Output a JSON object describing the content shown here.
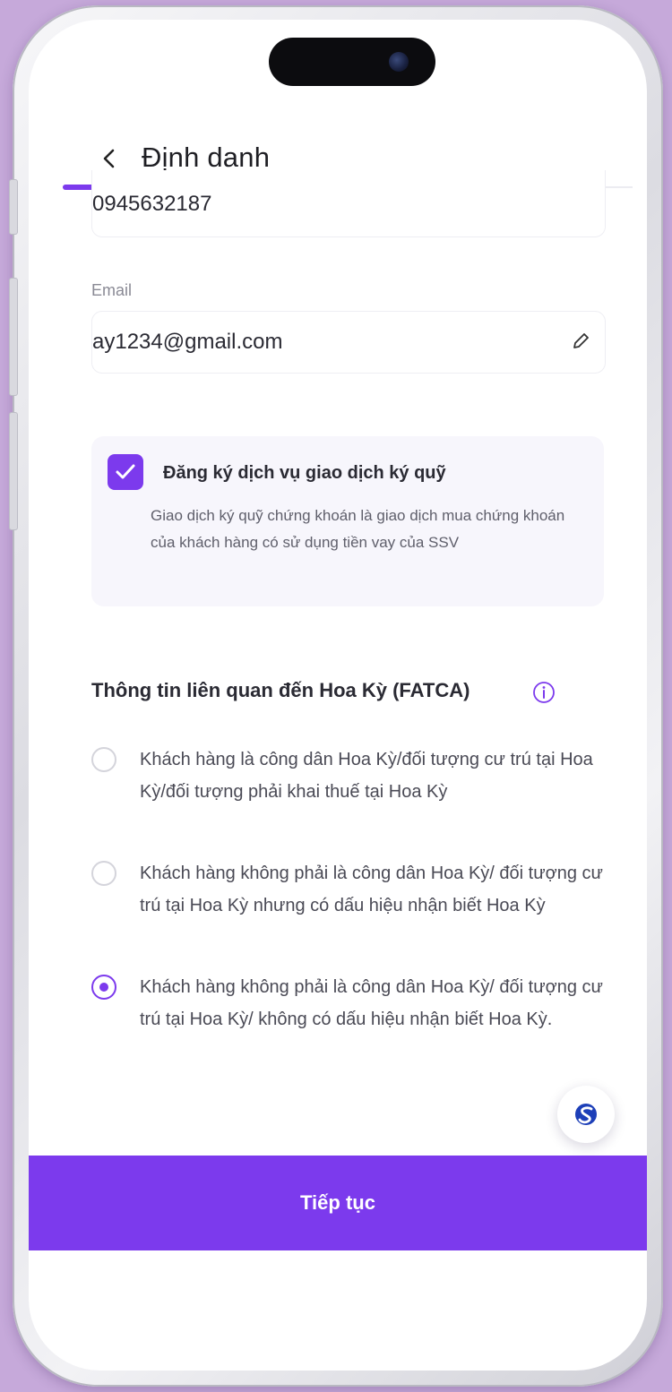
{
  "header": {
    "title": "Định danh",
    "back_icon": "chevron-left-icon"
  },
  "progress": {
    "fraction": 0.25
  },
  "phone_field": {
    "value": "0945632187"
  },
  "email_field": {
    "label": "Email",
    "value": "ay1234@gmail.com",
    "edit_icon": "pencil-icon"
  },
  "margin_service": {
    "checked": true,
    "title": "Đăng ký dịch vụ giao dịch ký quỹ",
    "description": "Giao dịch ký quỹ chứng khoán là giao dịch mua chứng khoán của khách hàng có sử dụng tiền vay của SSV"
  },
  "fatca": {
    "title": "Thông tin liên quan đến Hoa Kỳ (FATCA)",
    "info_icon": "info-icon",
    "options": [
      {
        "label": "Khách hàng là công dân Hoa Kỳ/đối tượng cư trú tại Hoa Kỳ/đối tượng phải khai thuế tại Hoa Kỳ",
        "selected": false
      },
      {
        "label": "Khách hàng không phải là công dân Hoa Kỳ/ đối tượng cư trú tại Hoa Kỳ nhưng có dấu hiệu nhận biết Hoa Kỳ",
        "selected": false
      },
      {
        "label": "Khách hàng không phải là công dân Hoa Kỳ/ đối tượng cư trú tại Hoa Kỳ/ không có dấu hiệu nhận biết Hoa Kỳ.",
        "selected": true
      }
    ]
  },
  "fab": {
    "icon": "brand-logo-icon"
  },
  "footer": {
    "continue_label": "Tiếp tục"
  },
  "colors": {
    "accent": "#7c3aed",
    "background": "#c6a9da"
  }
}
